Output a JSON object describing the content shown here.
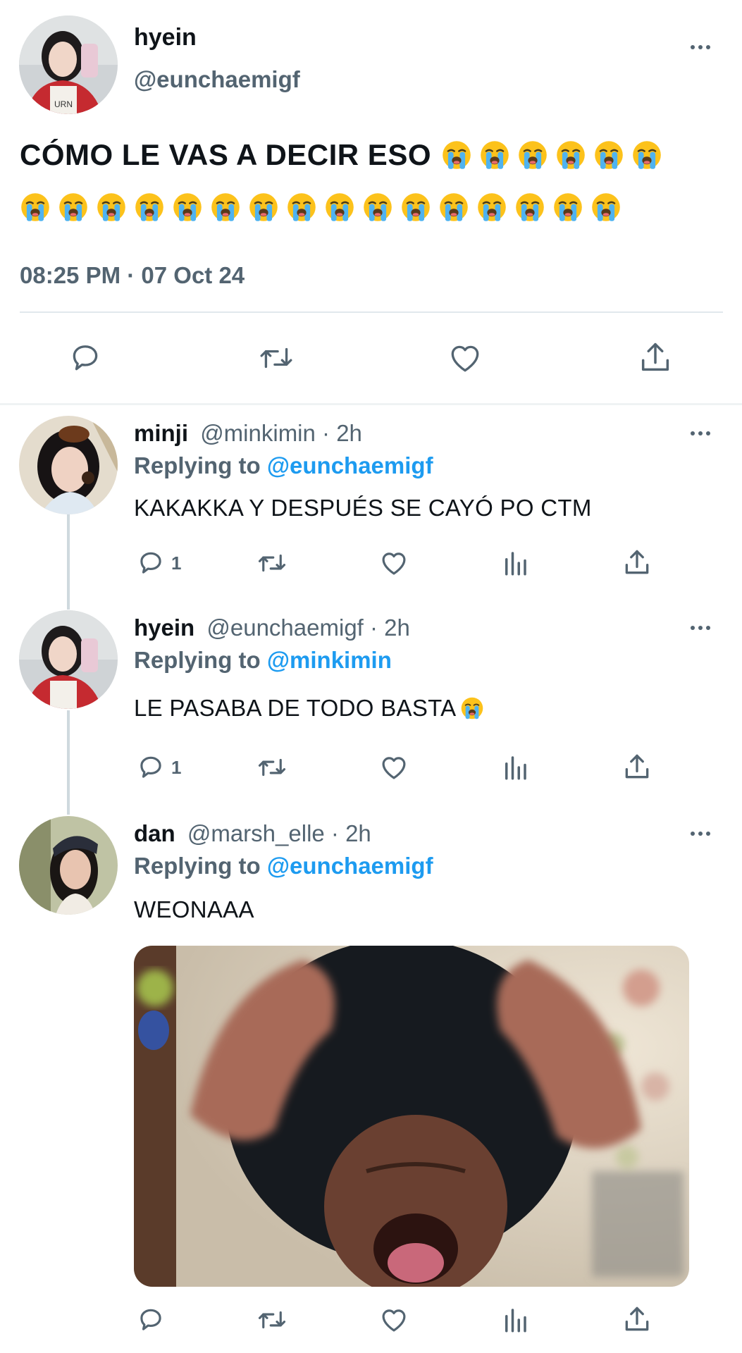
{
  "main_tweet": {
    "display_name": "hyein",
    "handle": "@eunchaemigf",
    "text": "CÓMO LE VAS A DECIR ESO",
    "emoji_name": "loudly-crying-face",
    "emoji_count_line1": 6,
    "emoji_count_line2": 16,
    "timestamp": "08:25 PM · 07 Oct 24",
    "actions": [
      "reply",
      "retweet",
      "like",
      "share"
    ]
  },
  "replies": [
    {
      "display_name": "minji",
      "meta": "@minkimin · 2h",
      "replying_prefix": "Replying to",
      "replying_to": "@eunchaemigf",
      "text": "KAKAKKA Y DESPUÉS SE CAYÓ PO CTM",
      "reply_count": "1"
    },
    {
      "display_name": "hyein",
      "meta": "@eunchaemigf · 2h",
      "replying_prefix": "Replying to",
      "replying_to": "@minkimin",
      "text": "LE PASABA DE TODO BASTA",
      "reply_count": "1"
    },
    {
      "display_name": "dan",
      "meta": "@marsh_elle · 2h",
      "replying_prefix": "Replying to",
      "replying_to": "@eunchaemigf",
      "text": "WEONAAA",
      "reply_count": ""
    }
  ],
  "colors": {
    "text": "#0f1419",
    "muted": "#536471",
    "link": "#1d9bf0",
    "divider": "#cfd9de"
  }
}
